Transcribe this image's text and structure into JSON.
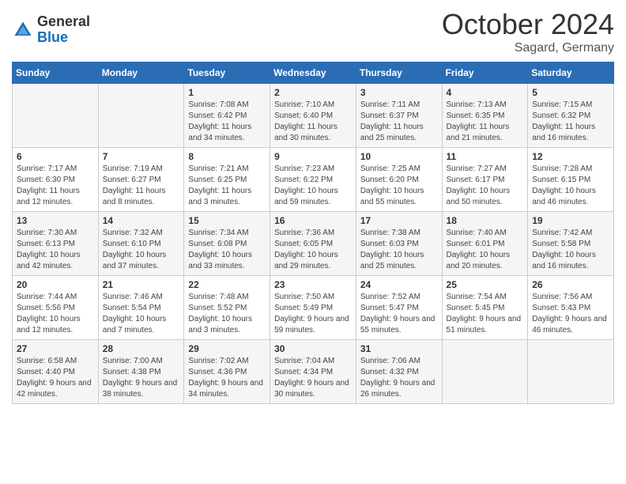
{
  "logo": {
    "general": "General",
    "blue": "Blue"
  },
  "header": {
    "month": "October 2024",
    "location": "Sagard, Germany"
  },
  "weekdays": [
    "Sunday",
    "Monday",
    "Tuesday",
    "Wednesday",
    "Thursday",
    "Friday",
    "Saturday"
  ],
  "weeks": [
    [
      {
        "day": "",
        "sunrise": "",
        "sunset": "",
        "daylight": ""
      },
      {
        "day": "",
        "sunrise": "",
        "sunset": "",
        "daylight": ""
      },
      {
        "day": "1",
        "sunrise": "Sunrise: 7:08 AM",
        "sunset": "Sunset: 6:42 PM",
        "daylight": "Daylight: 11 hours and 34 minutes."
      },
      {
        "day": "2",
        "sunrise": "Sunrise: 7:10 AM",
        "sunset": "Sunset: 6:40 PM",
        "daylight": "Daylight: 11 hours and 30 minutes."
      },
      {
        "day": "3",
        "sunrise": "Sunrise: 7:11 AM",
        "sunset": "Sunset: 6:37 PM",
        "daylight": "Daylight: 11 hours and 25 minutes."
      },
      {
        "day": "4",
        "sunrise": "Sunrise: 7:13 AM",
        "sunset": "Sunset: 6:35 PM",
        "daylight": "Daylight: 11 hours and 21 minutes."
      },
      {
        "day": "5",
        "sunrise": "Sunrise: 7:15 AM",
        "sunset": "Sunset: 6:32 PM",
        "daylight": "Daylight: 11 hours and 16 minutes."
      }
    ],
    [
      {
        "day": "6",
        "sunrise": "Sunrise: 7:17 AM",
        "sunset": "Sunset: 6:30 PM",
        "daylight": "Daylight: 11 hours and 12 minutes."
      },
      {
        "day": "7",
        "sunrise": "Sunrise: 7:19 AM",
        "sunset": "Sunset: 6:27 PM",
        "daylight": "Daylight: 11 hours and 8 minutes."
      },
      {
        "day": "8",
        "sunrise": "Sunrise: 7:21 AM",
        "sunset": "Sunset: 6:25 PM",
        "daylight": "Daylight: 11 hours and 3 minutes."
      },
      {
        "day": "9",
        "sunrise": "Sunrise: 7:23 AM",
        "sunset": "Sunset: 6:22 PM",
        "daylight": "Daylight: 10 hours and 59 minutes."
      },
      {
        "day": "10",
        "sunrise": "Sunrise: 7:25 AM",
        "sunset": "Sunset: 6:20 PM",
        "daylight": "Daylight: 10 hours and 55 minutes."
      },
      {
        "day": "11",
        "sunrise": "Sunrise: 7:27 AM",
        "sunset": "Sunset: 6:17 PM",
        "daylight": "Daylight: 10 hours and 50 minutes."
      },
      {
        "day": "12",
        "sunrise": "Sunrise: 7:28 AM",
        "sunset": "Sunset: 6:15 PM",
        "daylight": "Daylight: 10 hours and 46 minutes."
      }
    ],
    [
      {
        "day": "13",
        "sunrise": "Sunrise: 7:30 AM",
        "sunset": "Sunset: 6:13 PM",
        "daylight": "Daylight: 10 hours and 42 minutes."
      },
      {
        "day": "14",
        "sunrise": "Sunrise: 7:32 AM",
        "sunset": "Sunset: 6:10 PM",
        "daylight": "Daylight: 10 hours and 37 minutes."
      },
      {
        "day": "15",
        "sunrise": "Sunrise: 7:34 AM",
        "sunset": "Sunset: 6:08 PM",
        "daylight": "Daylight: 10 hours and 33 minutes."
      },
      {
        "day": "16",
        "sunrise": "Sunrise: 7:36 AM",
        "sunset": "Sunset: 6:05 PM",
        "daylight": "Daylight: 10 hours and 29 minutes."
      },
      {
        "day": "17",
        "sunrise": "Sunrise: 7:38 AM",
        "sunset": "Sunset: 6:03 PM",
        "daylight": "Daylight: 10 hours and 25 minutes."
      },
      {
        "day": "18",
        "sunrise": "Sunrise: 7:40 AM",
        "sunset": "Sunset: 6:01 PM",
        "daylight": "Daylight: 10 hours and 20 minutes."
      },
      {
        "day": "19",
        "sunrise": "Sunrise: 7:42 AM",
        "sunset": "Sunset: 5:58 PM",
        "daylight": "Daylight: 10 hours and 16 minutes."
      }
    ],
    [
      {
        "day": "20",
        "sunrise": "Sunrise: 7:44 AM",
        "sunset": "Sunset: 5:56 PM",
        "daylight": "Daylight: 10 hours and 12 minutes."
      },
      {
        "day": "21",
        "sunrise": "Sunrise: 7:46 AM",
        "sunset": "Sunset: 5:54 PM",
        "daylight": "Daylight: 10 hours and 7 minutes."
      },
      {
        "day": "22",
        "sunrise": "Sunrise: 7:48 AM",
        "sunset": "Sunset: 5:52 PM",
        "daylight": "Daylight: 10 hours and 3 minutes."
      },
      {
        "day": "23",
        "sunrise": "Sunrise: 7:50 AM",
        "sunset": "Sunset: 5:49 PM",
        "daylight": "Daylight: 9 hours and 59 minutes."
      },
      {
        "day": "24",
        "sunrise": "Sunrise: 7:52 AM",
        "sunset": "Sunset: 5:47 PM",
        "daylight": "Daylight: 9 hours and 55 minutes."
      },
      {
        "day": "25",
        "sunrise": "Sunrise: 7:54 AM",
        "sunset": "Sunset: 5:45 PM",
        "daylight": "Daylight: 9 hours and 51 minutes."
      },
      {
        "day": "26",
        "sunrise": "Sunrise: 7:56 AM",
        "sunset": "Sunset: 5:43 PM",
        "daylight": "Daylight: 9 hours and 46 minutes."
      }
    ],
    [
      {
        "day": "27",
        "sunrise": "Sunrise: 6:58 AM",
        "sunset": "Sunset: 4:40 PM",
        "daylight": "Daylight: 9 hours and 42 minutes."
      },
      {
        "day": "28",
        "sunrise": "Sunrise: 7:00 AM",
        "sunset": "Sunset: 4:38 PM",
        "daylight": "Daylight: 9 hours and 38 minutes."
      },
      {
        "day": "29",
        "sunrise": "Sunrise: 7:02 AM",
        "sunset": "Sunset: 4:36 PM",
        "daylight": "Daylight: 9 hours and 34 minutes."
      },
      {
        "day": "30",
        "sunrise": "Sunrise: 7:04 AM",
        "sunset": "Sunset: 4:34 PM",
        "daylight": "Daylight: 9 hours and 30 minutes."
      },
      {
        "day": "31",
        "sunrise": "Sunrise: 7:06 AM",
        "sunset": "Sunset: 4:32 PM",
        "daylight": "Daylight: 9 hours and 26 minutes."
      },
      {
        "day": "",
        "sunrise": "",
        "sunset": "",
        "daylight": ""
      },
      {
        "day": "",
        "sunrise": "",
        "sunset": "",
        "daylight": ""
      }
    ]
  ]
}
